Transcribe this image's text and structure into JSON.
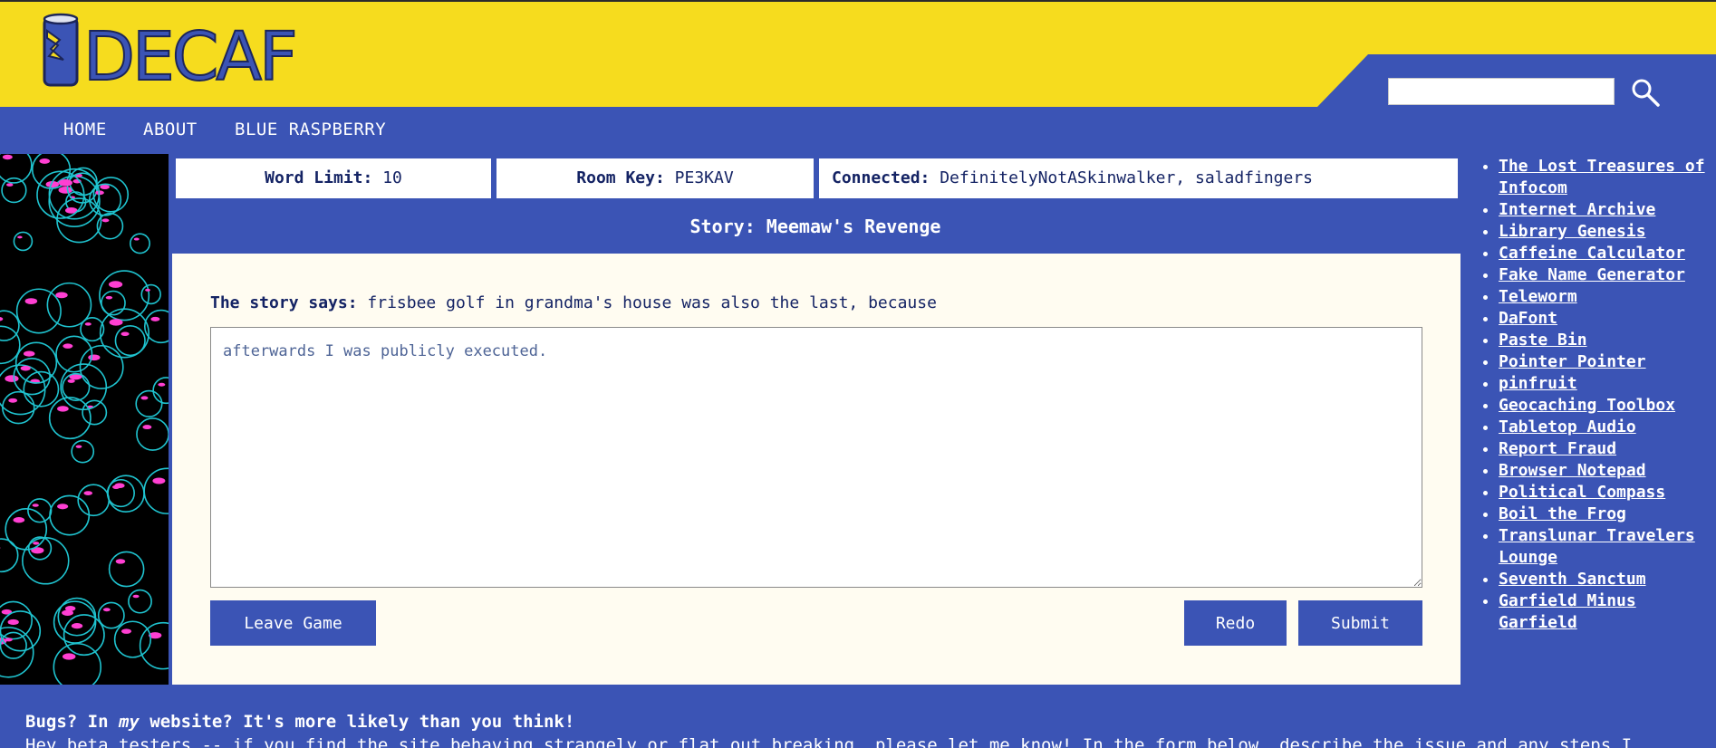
{
  "logo": {
    "text": "DECAF"
  },
  "search": {
    "value": "",
    "placeholder": ""
  },
  "nav": [
    {
      "label": "HOME"
    },
    {
      "label": "ABOUT"
    },
    {
      "label": "BLUE RASPBERRY"
    }
  ],
  "info": {
    "word_limit_label": "Word Limit:",
    "word_limit_value": "10",
    "room_key_label": "Room Key:",
    "room_key_value": "PE3KAV",
    "connected_label": "Connected:",
    "connected_value": "DefinitelyNotASkinwalker, saladfingers"
  },
  "story": {
    "title": "Story: Meemaw's Revenge",
    "says_label": "The story says:",
    "says_text": "frisbee golf in grandma's house was also the last, because",
    "entry_value": "afterwards I was publicly executed."
  },
  "buttons": {
    "leave": "Leave Game",
    "redo": "Redo",
    "submit": "Submit"
  },
  "links": [
    {
      "label": "The Lost Treasures of Infocom"
    },
    {
      "label": "Internet Archive"
    },
    {
      "label": "Library Genesis"
    },
    {
      "label": "Caffeine Calculator"
    },
    {
      "label": "Fake Name Generator"
    },
    {
      "label": "Teleworm"
    },
    {
      "label": "DaFont"
    },
    {
      "label": "Paste Bin"
    },
    {
      "label": "Pointer Pointer"
    },
    {
      "label": "pinfruit"
    },
    {
      "label": "Geocaching Toolbox"
    },
    {
      "label": "Tabletop Audio"
    },
    {
      "label": "Report Fraud"
    },
    {
      "label": "Browser Notepad"
    },
    {
      "label": "Political Compass"
    },
    {
      "label": "Boil the Frog"
    },
    {
      "label": "Translunar Travelers Lounge"
    },
    {
      "label": "Seventh Sanctum"
    },
    {
      "label": "Garfield Minus Garfield"
    }
  ],
  "footer": {
    "bugs_pre": "Bugs? In ",
    "bugs_em": "my",
    "bugs_post": " website? It's more likely than you think!",
    "beta": "Hey beta testers -- if you find the site behaving strangely or flat out breaking, please let me know! In the form below, describe the issue and any steps I"
  },
  "colors": {
    "header_yellow": "#f6dc1e",
    "brand_blue": "#3b54b5",
    "text_navy": "#142364",
    "panel_cream": "#fffcf1"
  }
}
